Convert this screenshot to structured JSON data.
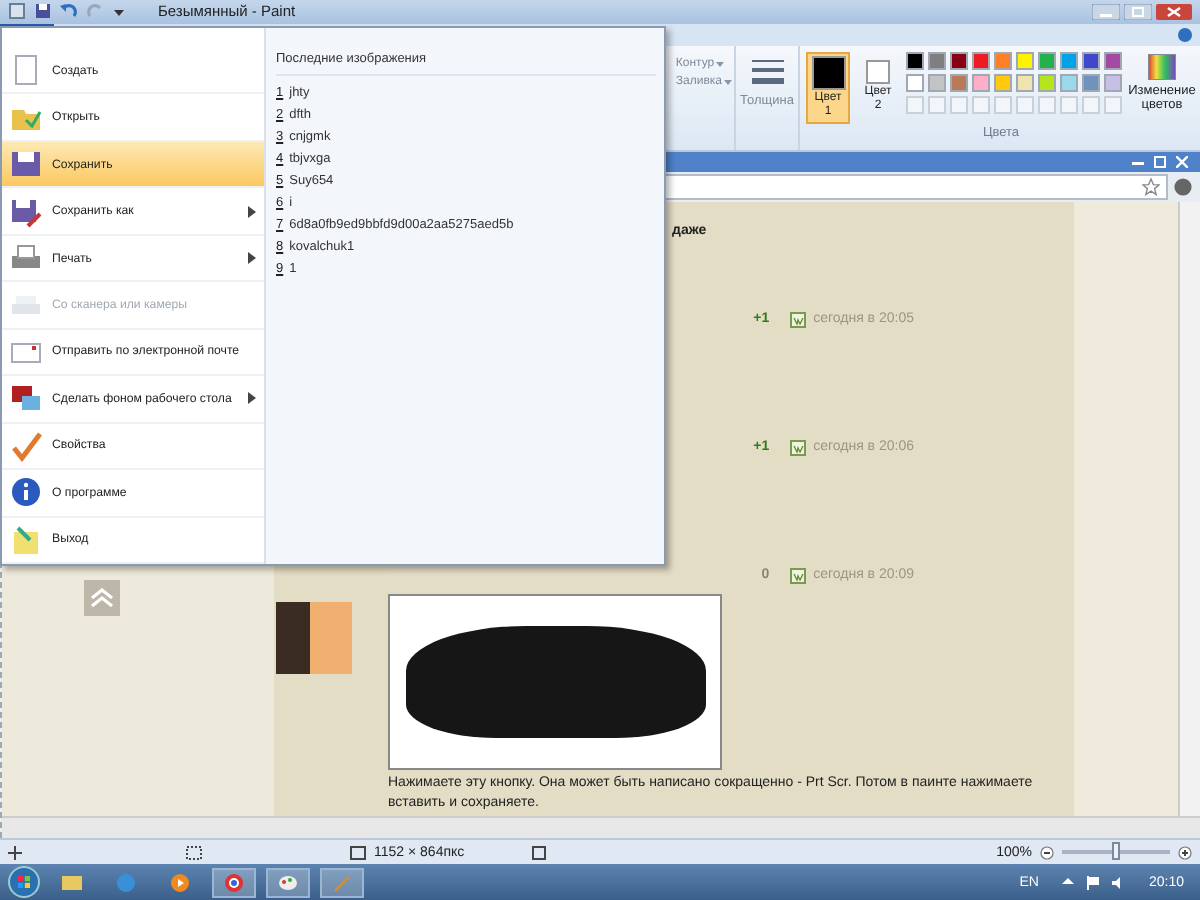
{
  "window": {
    "title": "Безымянный - Paint"
  },
  "file_menu": {
    "items": [
      {
        "kind": "new",
        "label": "Создать",
        "submenu": false,
        "disabled": false,
        "selected": false
      },
      {
        "kind": "open",
        "label": "Открыть",
        "submenu": false,
        "disabled": false,
        "selected": false
      },
      {
        "kind": "save",
        "label": "Сохранить",
        "submenu": false,
        "disabled": false,
        "selected": true
      },
      {
        "kind": "saveas",
        "label": "Сохранить как",
        "submenu": true,
        "disabled": false,
        "selected": false
      },
      {
        "kind": "print",
        "label": "Печать",
        "submenu": true,
        "disabled": false,
        "selected": false
      },
      {
        "kind": "scanner",
        "label": "Со сканера или камеры",
        "submenu": false,
        "disabled": true,
        "selected": false
      },
      {
        "kind": "email",
        "label": "Отправить по электронной почте",
        "submenu": false,
        "disabled": false,
        "selected": false
      },
      {
        "kind": "desktop",
        "label": "Сделать фоном рабочего стола",
        "submenu": true,
        "disabled": false,
        "selected": false
      },
      {
        "kind": "properties",
        "label": "Свойства",
        "submenu": false,
        "disabled": false,
        "selected": false
      },
      {
        "kind": "about",
        "label": "О программе",
        "submenu": false,
        "disabled": false,
        "selected": false
      },
      {
        "kind": "exit",
        "label": "Выход",
        "submenu": false,
        "disabled": false,
        "selected": false
      }
    ],
    "recent_title": "Последние изображения",
    "recent": [
      {
        "number": "1",
        "name": "jhty"
      },
      {
        "number": "2",
        "name": "dfth"
      },
      {
        "number": "3",
        "name": "cnjgmk"
      },
      {
        "number": "4",
        "name": "tbjvxga"
      },
      {
        "number": "5",
        "name": "Suy654"
      },
      {
        "number": "6",
        "name": "i"
      },
      {
        "number": "7",
        "name": "6d8a0fb9ed9bbfd9d00a2aa5275aed5b"
      },
      {
        "number": "8",
        "name": "kovalchuk1"
      },
      {
        "number": "9",
        "name": "1"
      }
    ]
  },
  "ribbon": {
    "shape_options": [
      {
        "label": "Контур",
        "disabled": true
      },
      {
        "label": "Заливка",
        "disabled": true
      }
    ],
    "thickness": {
      "label": "Толщина",
      "disabled": true
    },
    "color_slots": [
      {
        "label": "Цвет 1",
        "color": "#000000",
        "selected": true
      },
      {
        "label": "Цвет 2",
        "color": "#ffffff",
        "selected": false
      }
    ],
    "palette": [
      {
        "color": "#000000"
      },
      {
        "color": "#7f7f7f"
      },
      {
        "color": "#880015"
      },
      {
        "color": "#ed1c24"
      },
      {
        "color": "#ff7f27"
      },
      {
        "color": "#fff200"
      },
      {
        "color": "#22b14c"
      },
      {
        "color": "#00a2e8"
      },
      {
        "color": "#3f48cc"
      },
      {
        "color": "#a349a4"
      },
      {
        "color": "#ffffff"
      },
      {
        "color": "#c3c3c3"
      },
      {
        "color": "#b97a57"
      },
      {
        "color": "#ffaec9"
      },
      {
        "color": "#ffc90e"
      },
      {
        "color": "#efe4b0"
      },
      {
        "color": "#b5e61d"
      },
      {
        "color": "#99d9ea"
      },
      {
        "color": "#7092be"
      },
      {
        "color": "#c8bfe7"
      }
    ],
    "edit_colors": "Изменение цветов",
    "group_label": "Цвета"
  },
  "canvas": {
    "text_fragment": "даже",
    "posts": [
      {
        "votes": "+1",
        "color": "#2e7d1e",
        "time": "сегодня в 20:05"
      },
      {
        "votes": "+1",
        "color": "#2e7d1e",
        "time": "сегодня в 20:06"
      },
      {
        "votes": "0",
        "color": "#8a8470",
        "time": "сегодня в 20:09"
      }
    ],
    "post_text": "Нажимаете эту кнопку. Она может быть написано сокращенно - Prt Scr. Потом в паинте нажимаете вставить и сохраняете."
  },
  "status_bar": {
    "size": "1152 × 864пкс",
    "zoom": "100%",
    "level": 0.5
  },
  "taskbar": {
    "apps": [
      {
        "kind": "folder",
        "running": false
      },
      {
        "kind": "browser",
        "running": false
      },
      {
        "kind": "media",
        "running": false
      },
      {
        "kind": "chrome",
        "running": true
      },
      {
        "kind": "paint",
        "running": true
      },
      {
        "kind": "tool",
        "running": true
      }
    ],
    "language": "EN",
    "clock": "20:10"
  }
}
